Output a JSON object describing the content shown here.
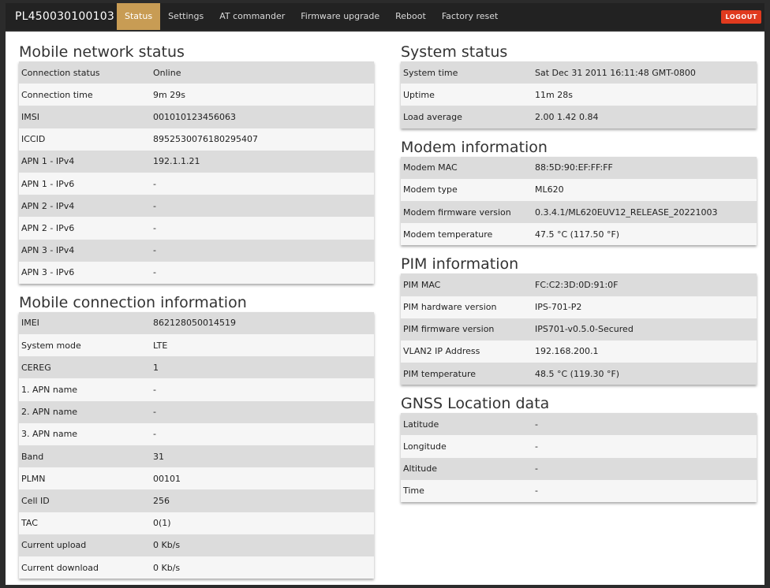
{
  "header": {
    "device_id": "PL450030100103",
    "nav": [
      "Status",
      "Settings",
      "AT commander",
      "Firmware upgrade",
      "Reboot",
      "Factory reset"
    ],
    "active_tab": "Status",
    "logout_label": "LOGOUT"
  },
  "mobile_network_status": {
    "title": "Mobile network status",
    "rows": [
      {
        "label": "Connection status",
        "value": "Online"
      },
      {
        "label": "Connection time",
        "value": "9m 29s"
      },
      {
        "label": "IMSI",
        "value": "001010123456063"
      },
      {
        "label": "ICCID",
        "value": "8952530076180295407"
      },
      {
        "label": "APN 1 - IPv4",
        "value": "192.1.1.21"
      },
      {
        "label": "APN 1 - IPv6",
        "value": "-"
      },
      {
        "label": "APN 2 - IPv4",
        "value": "-"
      },
      {
        "label": "APN 2 - IPv6",
        "value": "-"
      },
      {
        "label": "APN 3 - IPv4",
        "value": "-"
      },
      {
        "label": "APN 3 - IPv6",
        "value": "-"
      }
    ]
  },
  "mobile_connection_information": {
    "title": "Mobile connection information",
    "rows": [
      {
        "label": "IMEI",
        "value": "862128050014519"
      },
      {
        "label": "System mode",
        "value": "LTE"
      },
      {
        "label": "CEREG",
        "value": "1"
      },
      {
        "label": "1. APN name",
        "value": "-"
      },
      {
        "label": "2. APN name",
        "value": "-"
      },
      {
        "label": "3. APN name",
        "value": "-"
      },
      {
        "label": "Band",
        "value": "31"
      },
      {
        "label": "PLMN",
        "value": "00101"
      },
      {
        "label": "Cell ID",
        "value": "256"
      },
      {
        "label": "TAC",
        "value": "0(1)"
      },
      {
        "label": "Current upload",
        "value": "0 Kb/s"
      },
      {
        "label": "Current download",
        "value": "0 Kb/s"
      }
    ]
  },
  "system_status": {
    "title": "System status",
    "rows": [
      {
        "label": "System time",
        "value": "Sat Dec 31 2011 16:11:48 GMT-0800"
      },
      {
        "label": "Uptime",
        "value": "11m 28s"
      },
      {
        "label": "Load average",
        "value": "2.00 1.42 0.84"
      }
    ]
  },
  "modem_information": {
    "title": "Modem information",
    "rows": [
      {
        "label": "Modem MAC",
        "value": "88:5D:90:EF:FF:FF"
      },
      {
        "label": "Modem type",
        "value": "ML620"
      },
      {
        "label": "Modem firmware version",
        "value": "0.3.4.1/ML620EUV12_RELEASE_20221003"
      },
      {
        "label": "Modem temperature",
        "value": "47.5 °C (117.50 °F)"
      }
    ]
  },
  "pim_information": {
    "title": "PIM information",
    "rows": [
      {
        "label": "PIM MAC",
        "value": "FC:C2:3D:0D:91:0F"
      },
      {
        "label": "PIM hardware version",
        "value": "IPS-701-P2"
      },
      {
        "label": "PIM firmware version",
        "value": "IPS701-v0.5.0-Secured"
      },
      {
        "label": "VLAN2 IP Address",
        "value": "192.168.200.1"
      },
      {
        "label": "PIM temperature",
        "value": "48.5 °C (119.30 °F)"
      }
    ]
  },
  "gnss_location_data": {
    "title": "GNSS Location data",
    "rows": [
      {
        "label": "Latitude",
        "value": "-"
      },
      {
        "label": "Longitude",
        "value": "-"
      },
      {
        "label": "Altitude",
        "value": "-"
      },
      {
        "label": "Time",
        "value": "-"
      }
    ]
  },
  "colors": {
    "active_tab": "#c89c54",
    "logout": "#e03a1e",
    "navbar": "#222222"
  }
}
